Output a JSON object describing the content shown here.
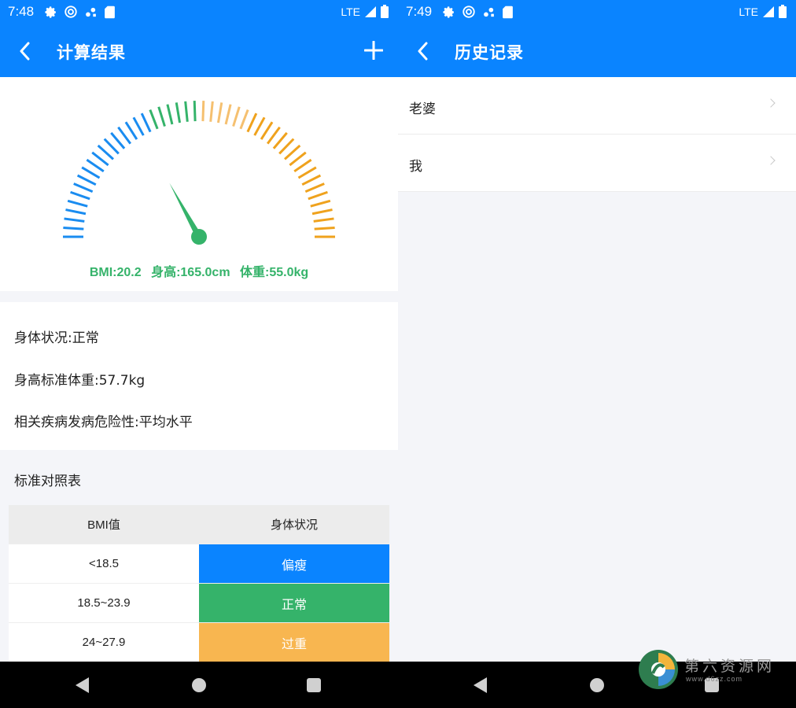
{
  "left": {
    "status": {
      "time": "7:48",
      "network": "LTE"
    },
    "appbar": {
      "title": "计算结果"
    },
    "gauge": {
      "bmi_text": "BMI:20.2",
      "height_text": "身高:165.0cm",
      "weight_text": "体重:55.0kg",
      "bmi_value": 20.2,
      "colors": {
        "blue": "#1a8cf0",
        "green": "#35b36a",
        "light_orange": "#f5c070",
        "orange": "#efa21d"
      }
    },
    "info": {
      "body_status": "身体状况:正常",
      "standard_weight": "身高标准体重:57.7kg",
      "risk": "相关疾病发病危险性:平均水平"
    },
    "table": {
      "title": "标准对照表",
      "headers": [
        "BMI值",
        "身体状况"
      ],
      "rows": [
        {
          "range": "<18.5",
          "status": "偏瘦",
          "color": "#0a84ff"
        },
        {
          "range": "18.5~23.9",
          "status": "正常",
          "color": "#35b36a"
        },
        {
          "range": "24~27.9",
          "status": "过重",
          "color": "#f8b650"
        }
      ]
    }
  },
  "right": {
    "status": {
      "time": "7:49",
      "network": "LTE"
    },
    "appbar": {
      "title": "历史记录"
    },
    "list": [
      {
        "label": "老婆"
      },
      {
        "label": "我"
      }
    ],
    "watermark": {
      "text": "第六资源网",
      "url": "www.d6zz.com"
    }
  }
}
